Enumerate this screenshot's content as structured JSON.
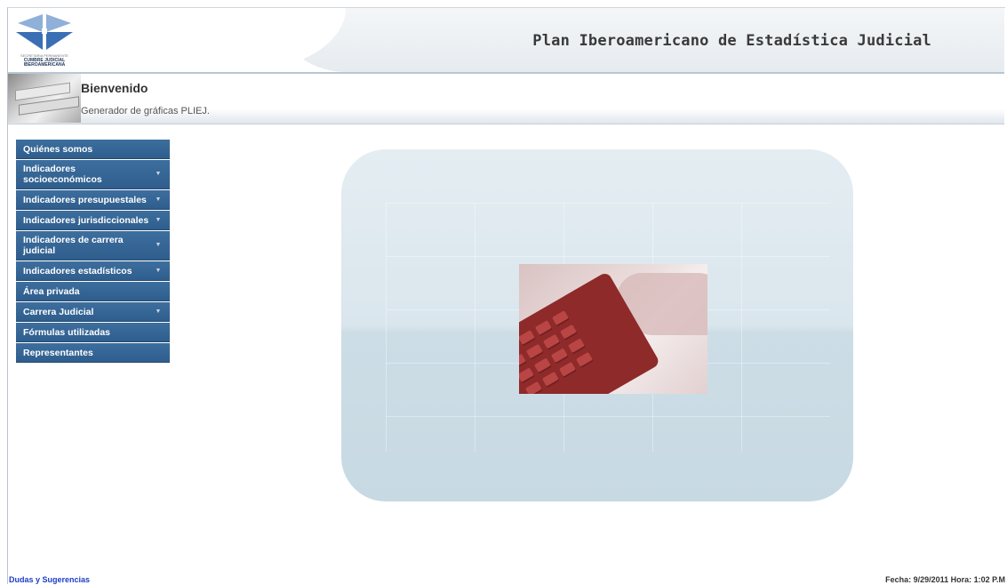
{
  "header": {
    "site_title": "Plan Iberoamericano de Estadística Judicial",
    "logo": {
      "icon": "cumbre-judicial-logo-icon",
      "line1": "SECRETARIA PERMANENTE",
      "line2": "CUMBRE JUDICIAL",
      "line3": "IBEROAMERICANA",
      "colors": {
        "blue": "#3b6fb5",
        "light": "#8fb0d9"
      }
    }
  },
  "welcome": {
    "title": "Bienvenido",
    "subtitle": "Generador de gráficas PLIEJ."
  },
  "menu": {
    "items": [
      {
        "label": "Quiénes somos",
        "has_submenu": false
      },
      {
        "label": "Indicadores socioeconómicos",
        "has_submenu": true
      },
      {
        "label": "Indicadores presupuestales",
        "has_submenu": true
      },
      {
        "label": "Indicadores jurisdiccionales",
        "has_submenu": true
      },
      {
        "label": "Indicadores de carrera judicial",
        "has_submenu": true
      },
      {
        "label": "Indicadores estadísticos",
        "has_submenu": true
      },
      {
        "label": "Área privada",
        "has_submenu": false
      },
      {
        "label": "Carrera Judicial",
        "has_submenu": true
      },
      {
        "label": "Fórmulas utilizadas",
        "has_submenu": false
      },
      {
        "label": "Representantes",
        "has_submenu": false
      }
    ],
    "arrow_glyph": "▼",
    "color": "#2f5e8d"
  },
  "footer": {
    "link": "Dudas y Sugerencias",
    "datetime": "Fecha: 9/29/2011 Hora: 1:02 P.M"
  }
}
